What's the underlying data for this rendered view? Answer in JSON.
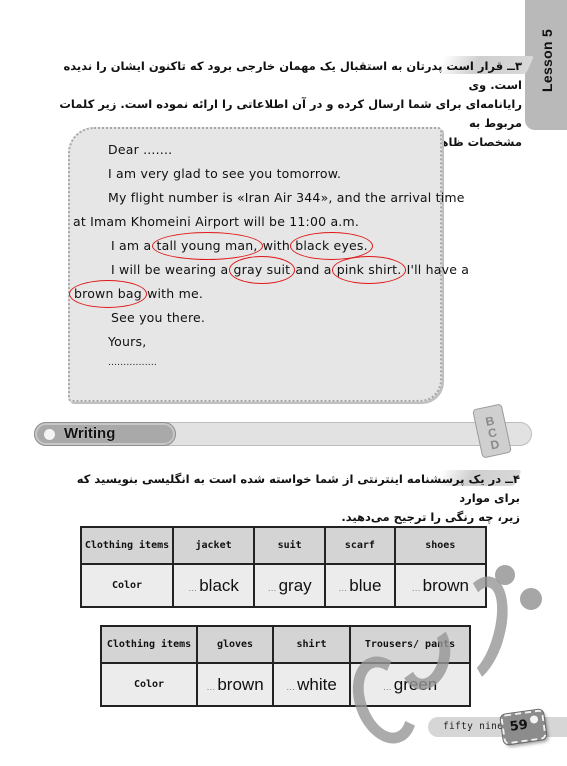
{
  "side_tab": {
    "label": "Lesson 5"
  },
  "exercise3": {
    "lines": [
      "۳ــ قرار است پدرتان به استقبال یک مهمان خارجی برود که تاکنون ایشان را ندیده است. وی",
      "رایانامه‌ای برای شما ارسال کرده و در آن اطلاعاتی را ارائه نموده است. زیر کلمات مربوط به",
      "مشخصات ظاهری او خط بکشید."
    ]
  },
  "letter": {
    "greeting": "Dear .......",
    "line1": "I am very glad to see you tomorrow.",
    "line2": "My flight number is «Iran Air 344», and the arrival time",
    "line3": "at Imam Khomeini Airport will be 11:00 a.m.",
    "line4": {
      "pre": "I am a ",
      "c1": "tall young man,",
      "mid": " with ",
      "c2": "black eyes."
    },
    "line5": {
      "pre": "I will be wearing a ",
      "c1": "gray suit",
      "mid": " and a ",
      "c2": "pink shirt.",
      "post": " I'll have a"
    },
    "line6": {
      "c1": "brown bag",
      "post": " with me."
    },
    "line7": "See you there.",
    "closing": "Yours,",
    "signature": "................"
  },
  "writing_section": {
    "label": "Writing",
    "icon": "abc-books-icon"
  },
  "exercise4": {
    "lines": [
      "۴ــ در یک پرسشنامه اینترنتی از شما خواسته شده است به انگلیسی بنویسید که برای موارد",
      "زیر، چه رنگی را ترجیح می‌دهید."
    ]
  },
  "table1": {
    "header_label": "Clothing items",
    "row_label": "Color",
    "items": [
      "jacket",
      "suit",
      "scarf",
      "shoes"
    ],
    "colors": [
      "black",
      "gray",
      "blue",
      "brown"
    ]
  },
  "table2": {
    "header_label": "Clothing items",
    "row_label": "Color",
    "items": [
      "gloves",
      "shirt",
      "Trousers/ pants"
    ],
    "colors": [
      "brown",
      "white",
      "green"
    ]
  },
  "footer": {
    "page_words": "fifty nine",
    "page_number": "59"
  },
  "colors": {
    "circle_annotation": "#e01818",
    "panel_gray": "#e6e6e6",
    "tab_gray": "#b9b9b9"
  }
}
